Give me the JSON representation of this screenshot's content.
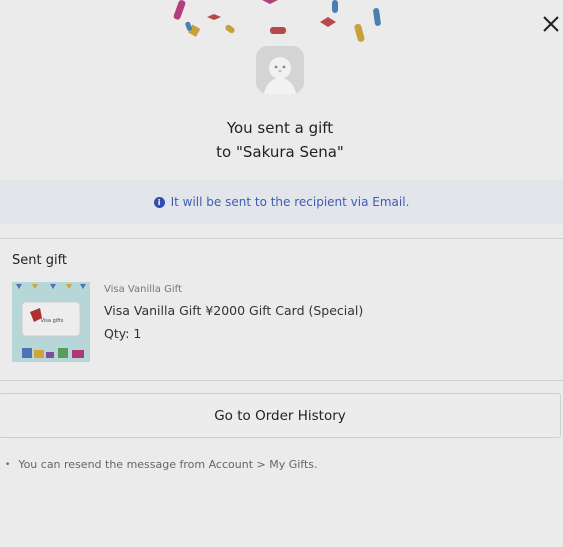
{
  "modal": {
    "close_icon": "close-icon",
    "title_line1": "You sent a gift",
    "title_line2": "to \"Sakura Sena\"",
    "notice": "It will be sent to the recipient via Email.",
    "notice_icon": "info-icon",
    "section_title": "Sent gift",
    "item": {
      "brand": "Visa Vanilla Gift",
      "name": "Visa Vanilla Gift ¥2000 Gift Card (Special)",
      "qty": "Qty: 1",
      "card_text": "Visa gifts"
    },
    "order_history_button": "Go to Order History",
    "note": "You can resend the message from Account > My Gifts."
  },
  "colors": {
    "background": "#ebebeb",
    "notice_bg": "#e2e5ea",
    "notice_text": "#3e5db8"
  }
}
